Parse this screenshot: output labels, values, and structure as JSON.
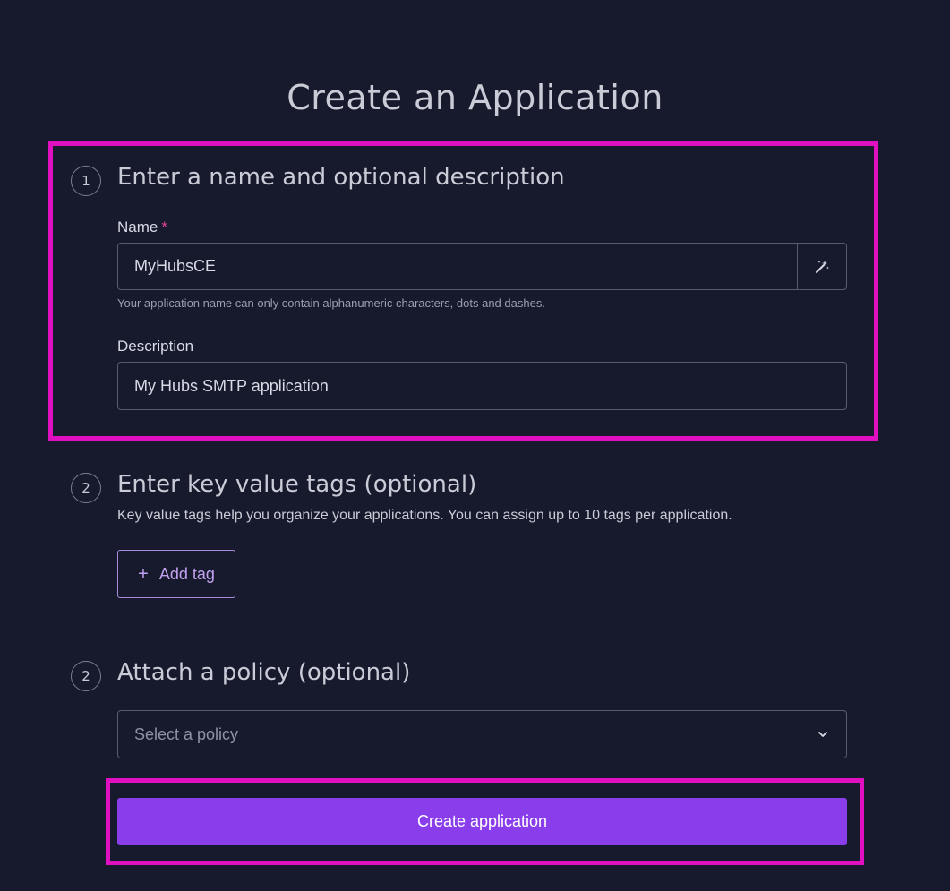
{
  "page": {
    "title": "Create an Application"
  },
  "step1": {
    "number": "1",
    "title": "Enter a name and optional description",
    "name_label": "Name",
    "name_required": "*",
    "name_value": "MyHubsCE",
    "name_suffix_icon": "magic-wand-icon",
    "name_helper": "Your application name can only contain alphanumeric characters, dots and dashes.",
    "description_label": "Description",
    "description_value": "My Hubs SMTP application"
  },
  "step2": {
    "number": "2",
    "title": "Enter key value tags (optional)",
    "description": "Key value tags help you organize your applications. You can assign up to 10 tags per application.",
    "add_tag_icon": "plus-icon",
    "add_tag_label": "Add tag"
  },
  "step3": {
    "number": "2",
    "title": "Attach a policy (optional)",
    "policy_placeholder": "Select a policy",
    "policy_icon": "chevron-down-icon"
  },
  "actions": {
    "create_label": "Create application"
  },
  "colors": {
    "background": "#161a2c",
    "highlight": "#e010c0",
    "primary": "#8a3dea",
    "tag_accent": "#c2a2f0",
    "required": "#e0449a"
  }
}
